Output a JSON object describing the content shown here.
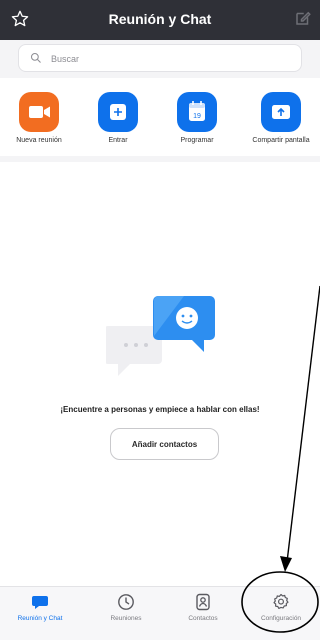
{
  "header": {
    "title": "Reunión y Chat",
    "left_icon": "star-icon",
    "right_icon": "compose-icon"
  },
  "search": {
    "placeholder": "Buscar",
    "value": ""
  },
  "actions": [
    {
      "label": "Nueva reunión",
      "icon": "video-camera-icon",
      "color": "#f26d21"
    },
    {
      "label": "Entrar",
      "icon": "plus-icon",
      "color": "#0e71eb"
    },
    {
      "label": "Programar",
      "icon": "calendar-icon",
      "color": "#0e71eb",
      "calendar_day": "19"
    },
    {
      "label": "Compartir pantalla",
      "icon": "share-screen-icon",
      "color": "#0e71eb"
    }
  ],
  "empty_state": {
    "message": "¡Encuentre a personas y empiece a hablar con ellas!",
    "button_label": "Añadir contactos"
  },
  "tabbar": {
    "tabs": [
      {
        "label": "Reunión y Chat",
        "icon": "chat-bubble-icon",
        "active": true
      },
      {
        "label": "Reuniones",
        "icon": "clock-icon",
        "active": false
      },
      {
        "label": "Contactos",
        "icon": "contacts-icon",
        "active": false
      },
      {
        "label": "Configuración",
        "icon": "gear-icon",
        "active": false
      }
    ]
  },
  "colors": {
    "header_bg": "#2f3037",
    "accent": "#0e71eb",
    "orange": "#f26d21"
  }
}
